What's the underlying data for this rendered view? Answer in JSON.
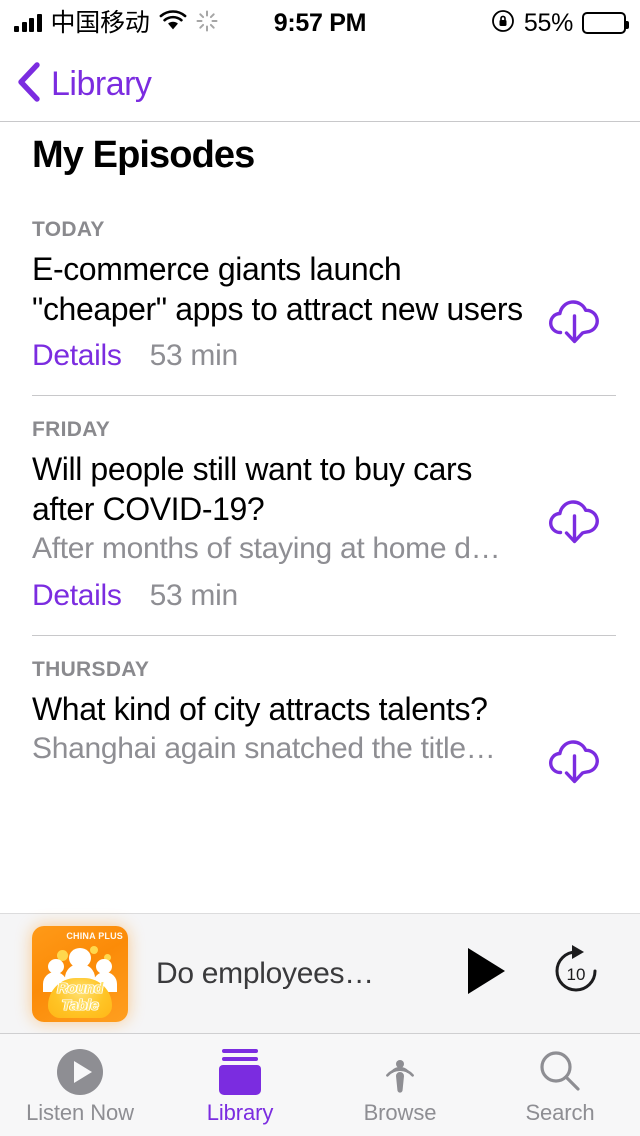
{
  "status_bar": {
    "carrier": "中国移动",
    "time": "9:57 PM",
    "battery_percent": "55%",
    "battery_level": 55,
    "icons": [
      "signal-bars-icon",
      "wifi-icon",
      "activity-spinner-icon",
      "rotation-lock-icon",
      "battery-icon"
    ]
  },
  "nav": {
    "back_label": "Library",
    "back_icon": "chevron-left-icon"
  },
  "page": {
    "title": "My Episodes"
  },
  "episodes": [
    {
      "day": "TODAY",
      "title": "E-commerce giants launch \"cheaper\" apps to attract new users",
      "subtitle": "",
      "details_label": "Details",
      "duration": "53 min",
      "download_icon": "cloud-download-icon"
    },
    {
      "day": "FRIDAY",
      "title": "Will people still want to buy cars after COVID-19?",
      "subtitle": "After months of staying at home d…",
      "details_label": "Details",
      "duration": "53 min",
      "download_icon": "cloud-download-icon"
    },
    {
      "day": "THURSDAY",
      "title": "What kind of city attracts talents?",
      "subtitle": "Shanghai again snatched the title…",
      "details_label": "",
      "duration": "",
      "download_icon": "cloud-download-icon"
    }
  ],
  "mini_player": {
    "artwork_brand": "CHINA PLUS",
    "artwork_line1": "Round",
    "artwork_line2": "Table",
    "now_playing": "Do employees…",
    "play_icon": "play-icon",
    "skip_icon": "skip-forward-10-icon",
    "skip_seconds": "10"
  },
  "tabs": [
    {
      "label": "Listen Now",
      "icon": "play-circle-icon",
      "active": false
    },
    {
      "label": "Library",
      "icon": "library-books-icon",
      "active": true
    },
    {
      "label": "Browse",
      "icon": "podcast-antenna-icon",
      "active": false
    },
    {
      "label": "Search",
      "icon": "magnifier-icon",
      "active": false
    }
  ],
  "colors": {
    "accent": "#7B2CE0",
    "secondary_text": "#8E8E93",
    "separator": "#C8C8CA",
    "artwork_orange": "#FB8B08"
  }
}
